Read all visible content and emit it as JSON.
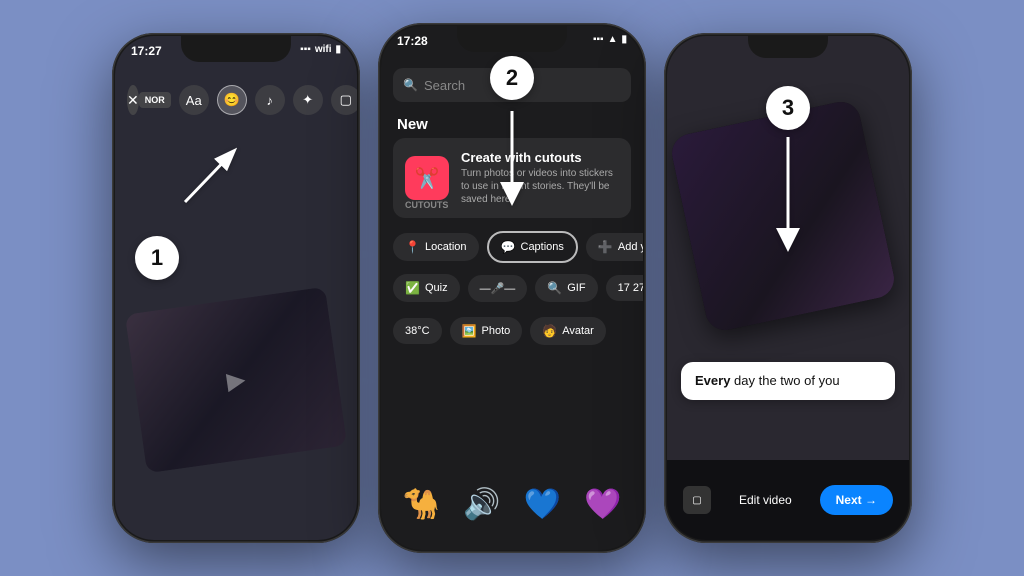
{
  "background_color": "#7b8fc4",
  "phones": [
    {
      "id": "phone1",
      "time": "17:27",
      "step_number": "1",
      "toolbar": {
        "close_label": "✕",
        "icons": [
          "Aa",
          "😊",
          "♪",
          "✦",
          "▢",
          "↓"
        ],
        "active_icon_index": 1,
        "tag_label": "NOR"
      }
    },
    {
      "id": "phone2",
      "time": "17:28",
      "step_number": "2",
      "search_placeholder": "Search",
      "section_label": "New",
      "cutouts": {
        "title": "Create with cutouts",
        "description": "Turn photos or videos into stickers to use in recent stories. They'll be saved here.",
        "label": "CUTOUTS"
      },
      "sticker_rows": [
        [
          {
            "icon": "📍",
            "label": "Location"
          },
          {
            "icon": "💬",
            "label": "Captions",
            "active": true
          },
          {
            "icon": "➕",
            "label": "Add yours"
          }
        ],
        [
          {
            "icon": "✅",
            "label": "Quiz"
          },
          {
            "emoji": "—🎤—"
          },
          {
            "icon": "🔍",
            "label": "GIF"
          },
          {
            "label": "17 27"
          }
        ],
        [
          {
            "label": "38°C"
          },
          {
            "icon": "🖼️",
            "label": "Photo"
          },
          {
            "icon": "🧑",
            "label": "Avatar"
          }
        ]
      ],
      "sticker_emojis": [
        "🐪",
        "🔊",
        "💙",
        "💜"
      ]
    },
    {
      "id": "phone3",
      "time": "",
      "step_number": "3",
      "caption": {
        "bold": "Every",
        "rest": " day the two of you"
      },
      "bottom": {
        "edit_label": "Edit video",
        "next_label": "Next →"
      }
    }
  ]
}
